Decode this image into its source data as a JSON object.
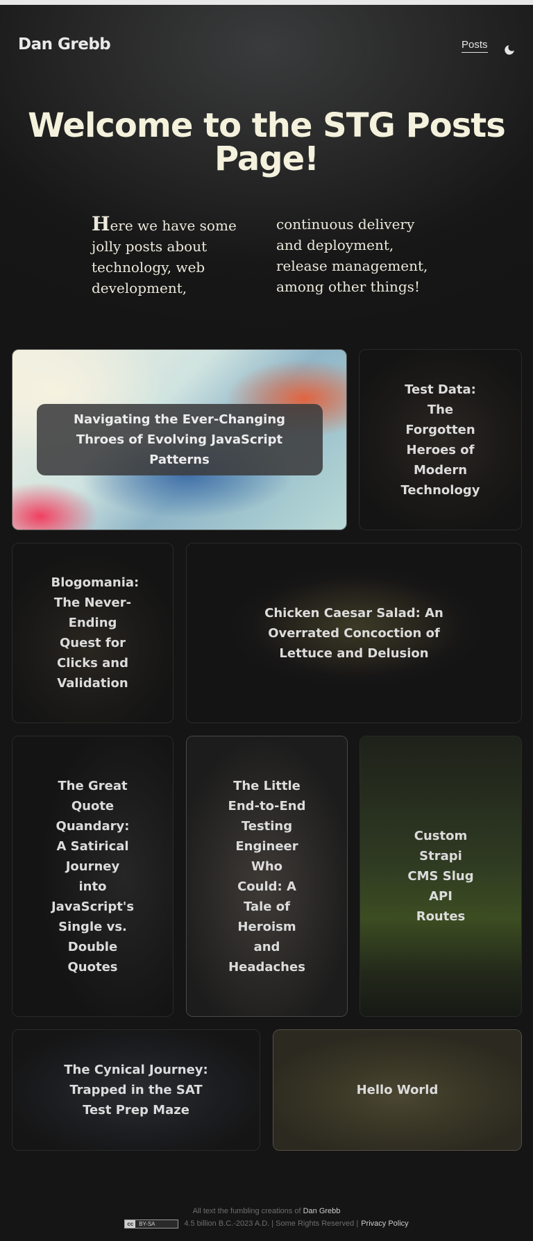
{
  "header": {
    "brand": "Dan Grebb",
    "nav": {
      "posts_label": "Posts"
    },
    "theme_toggle_icon": "moon-icon"
  },
  "hero": {
    "title": "Welcome to the STG Posts Page!",
    "intro": "Here we have some jolly posts about technology, web development, continuous delivery and deployment, release management, among other things!"
  },
  "posts": [
    {
      "title": "Navigating the Ever-Changing Throes of Evolving JavaScript Patterns"
    },
    {
      "title": "Test Data: The Forgotten Heroes of Modern Technology"
    },
    {
      "title": "Blogomania: The Never-Ending Quest for Clicks and Validation"
    },
    {
      "title": "Chicken Caesar Salad: An Overrated Concoction of Lettuce and Delusion"
    },
    {
      "title": "The Great Quote Quandary: A Satirical Journey into JavaScript's Single vs. Double Quotes"
    },
    {
      "title": "The Little End-to-End Testing Engineer Who Could: A Tale of Heroism and Headaches"
    },
    {
      "title": "Custom Strapi CMS Slug API Routes"
    },
    {
      "title": "The Cynical Journey: Trapped in the SAT Test Prep Maze"
    },
    {
      "title": "Hello World"
    }
  ],
  "footer": {
    "credit_prefix": "All text the fumbling creations of",
    "credit_name": "Dan Grebb",
    "license_badge_cc": "cc",
    "license_badge_text": "BY-SA",
    "copyright": "4.5 billion B.C.-2023 A.D. | Some Rights Reserved |",
    "privacy_label": "Privacy Policy"
  },
  "colors": {
    "background": "#151515",
    "hero_title": "#f4f1dc",
    "text": "#e6e6e6"
  }
}
